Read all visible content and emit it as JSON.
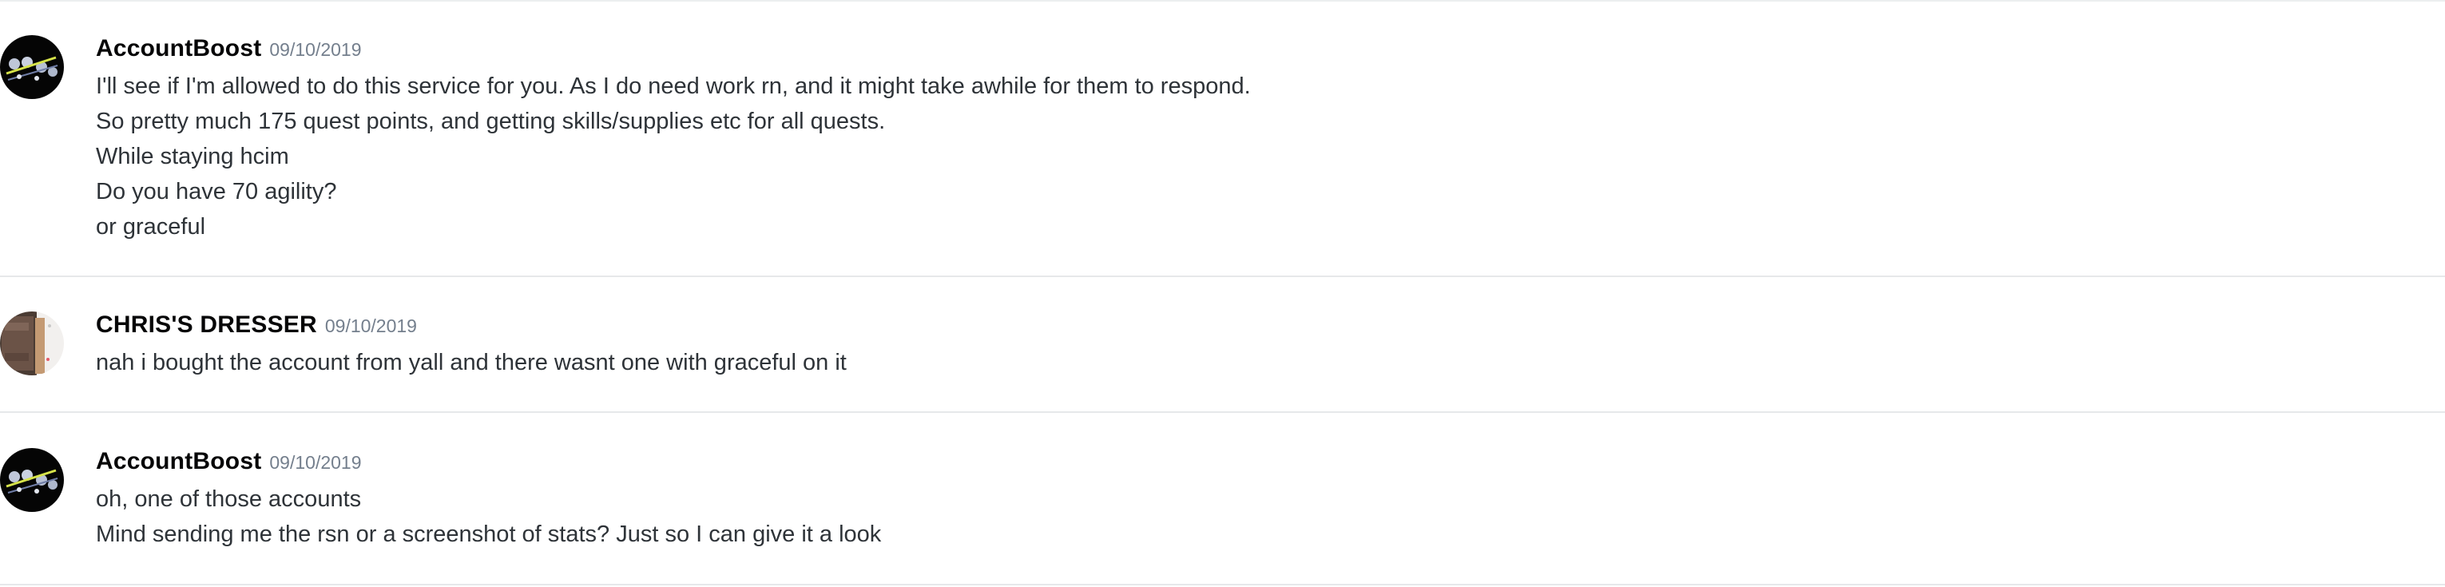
{
  "messages": [
    {
      "author": "AccountBoost",
      "timestamp": "09/10/2019",
      "avatar_icon": "accountboost-logo",
      "lines": [
        "I'll see if I'm allowed to do this service for you. As I do need work rn, and it might take awhile for them to respond.",
        "So pretty much 175 quest points, and getting skills/supplies etc for all quests.",
        "While staying hcim",
        "Do you have 70 agility?",
        "or graceful"
      ]
    },
    {
      "author": "CHRIS'S DRESSER",
      "timestamp": "09/10/2019",
      "avatar_icon": "dresser-photo",
      "lines": [
        "nah i bought the account from yall and there wasnt one with graceful on it"
      ]
    },
    {
      "author": "AccountBoost",
      "timestamp": "09/10/2019",
      "avatar_icon": "accountboost-logo",
      "lines": [
        "oh, one of those accounts",
        "Mind sending me the rsn or a screenshot of stats? Just so I can give it a look"
      ]
    }
  ],
  "colors": {
    "username": "#060607",
    "timestamp": "#747f8d",
    "message_text": "#2e3338",
    "divider": "#e6e8ea"
  }
}
